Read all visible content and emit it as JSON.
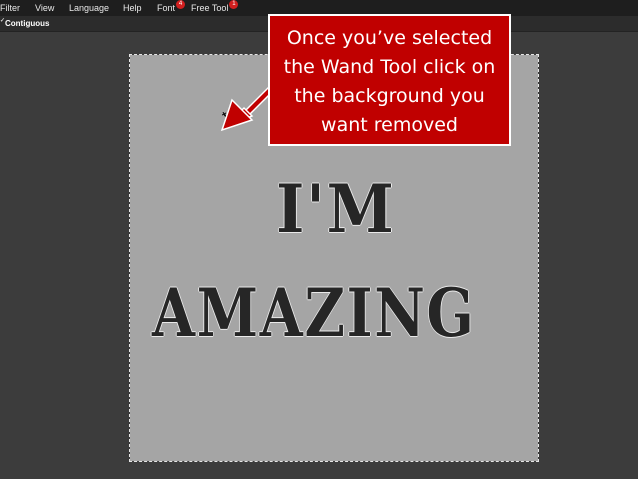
{
  "menu": {
    "items": [
      {
        "label": "Filter"
      },
      {
        "label": "View"
      },
      {
        "label": "Language"
      },
      {
        "label": "Help"
      },
      {
        "label": "Font",
        "badge": "4"
      },
      {
        "label": "Free Tool",
        "badge": "1"
      }
    ]
  },
  "options": {
    "contiguous_label": "Contiguous",
    "checked": true
  },
  "canvas": {
    "line1": "I'M",
    "line2": "AMAZING"
  },
  "callout": {
    "text": "Once you’ve selected the Wand Tool click on the background you want removed"
  },
  "colors": {
    "callout_bg": "#c00000",
    "canvas_bg": "#a5a5a5",
    "badge": "#d11f1f"
  }
}
